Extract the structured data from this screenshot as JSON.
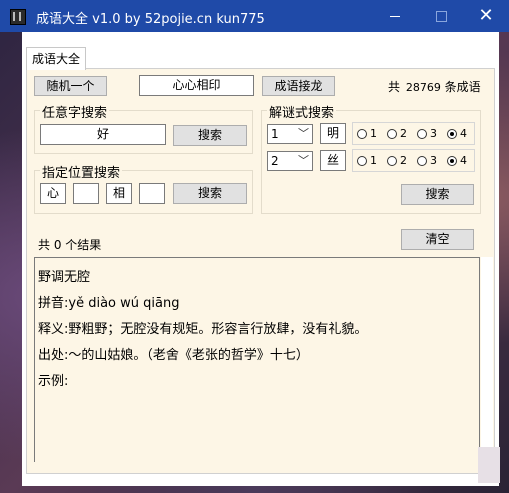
{
  "window": {
    "title": "成语大全 v1.0 by 52pojie.cn kun775",
    "close_glyph": "✕"
  },
  "tab": {
    "label": "成语大全"
  },
  "top": {
    "random_label": "随机一个",
    "current_idiom": "心心相印",
    "chain_label": "成语接龙",
    "count_prefix": "共",
    "count_value": "28769",
    "count_suffix": "条成语"
  },
  "any_search": {
    "title": "任意字搜索",
    "value": "好",
    "button": "搜索"
  },
  "pos_search": {
    "title": "指定位置搜索",
    "chars": [
      "心",
      "",
      "相",
      ""
    ],
    "button": "搜索"
  },
  "riddle": {
    "title": "解谜式搜索",
    "rows": [
      {
        "select": "1",
        "char": "明",
        "options": [
          "1",
          "2",
          "3",
          "4"
        ],
        "selected": "4"
      },
      {
        "select": "2",
        "char": "丝",
        "options": [
          "1",
          "2",
          "3",
          "4"
        ],
        "selected": "4"
      }
    ],
    "button": "搜索"
  },
  "results": {
    "count_text": "共 0 个结果",
    "clear_label": "清空"
  },
  "detail": {
    "line1": "野调无腔",
    "line2": "拼音:yě diào wú qiāng",
    "line3": "释义:野粗野；无腔没有规矩。形容言行放肆，没有礼貌。",
    "line4": "出处:～的山姑娘。（老舍《老张的哲学》十七）",
    "line5": "示例:"
  },
  "icons": [
    "app-icon",
    "minimize-icon",
    "maximize-icon",
    "close-icon",
    "chevron-down-icon"
  ]
}
